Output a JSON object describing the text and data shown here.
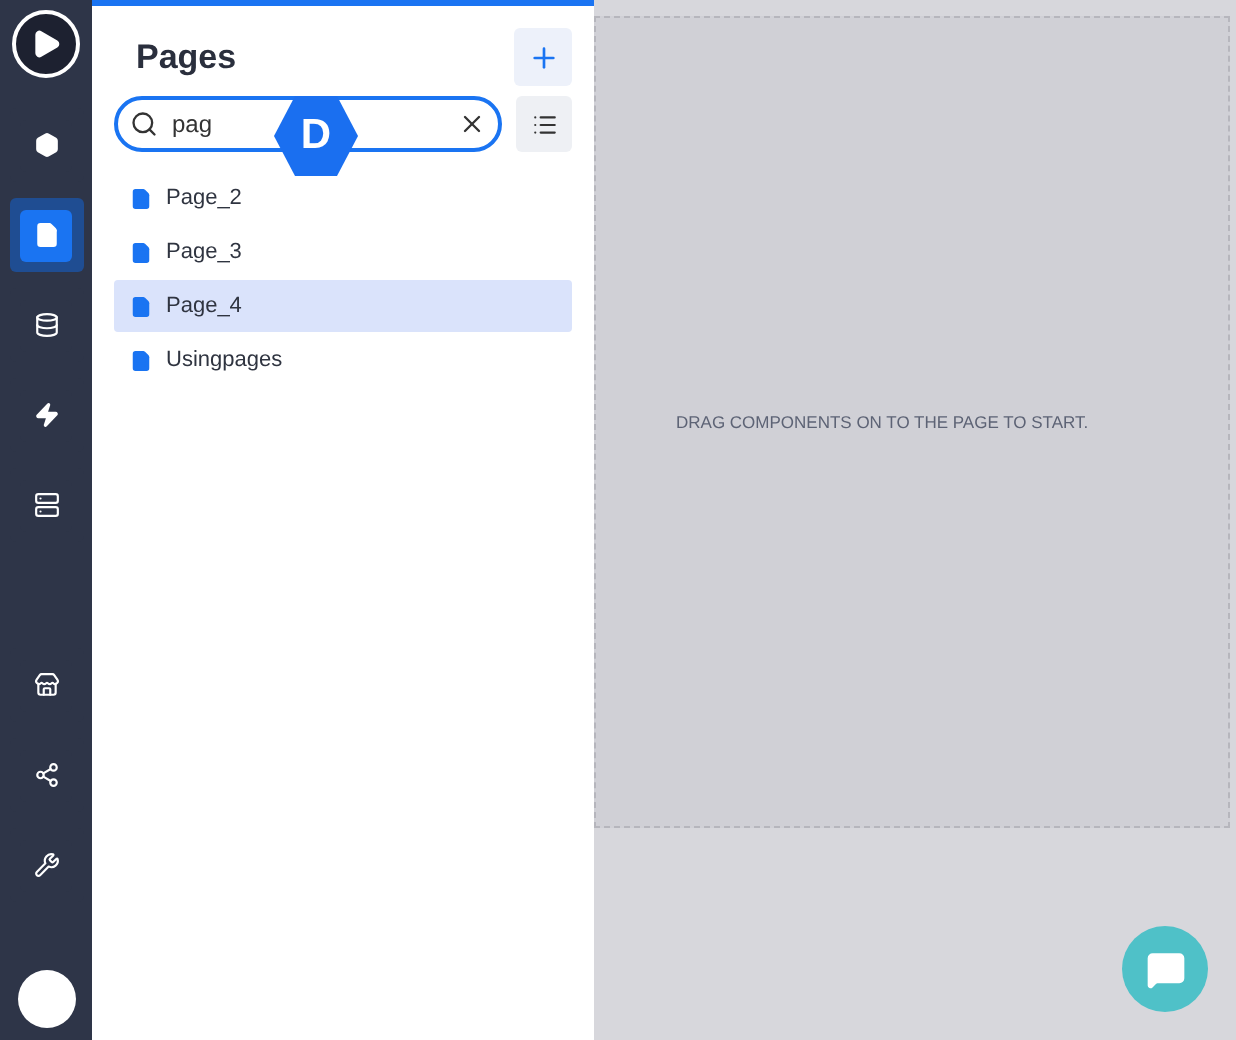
{
  "sidebar": {
    "top_items": [
      {
        "kind": "bee",
        "selected": false
      },
      {
        "kind": "page",
        "selected": true
      },
      {
        "kind": "database",
        "selected": false
      },
      {
        "kind": "bolt",
        "selected": false
      },
      {
        "kind": "server",
        "selected": false
      }
    ],
    "bottom_items": [
      {
        "kind": "store",
        "selected": false
      },
      {
        "kind": "share",
        "selected": false
      },
      {
        "kind": "tools",
        "selected": false
      }
    ]
  },
  "panel": {
    "title": "Pages",
    "search": {
      "value": "pag"
    },
    "badge": "D",
    "pages": [
      {
        "label": "Page_2",
        "selected": false
      },
      {
        "label": "Page_3",
        "selected": false
      },
      {
        "label": "Page_4",
        "selected": true
      },
      {
        "label": "Usingpages",
        "selected": false
      }
    ]
  },
  "canvas": {
    "hint": "DRAG COMPONENTS ON TO THE PAGE TO START."
  }
}
